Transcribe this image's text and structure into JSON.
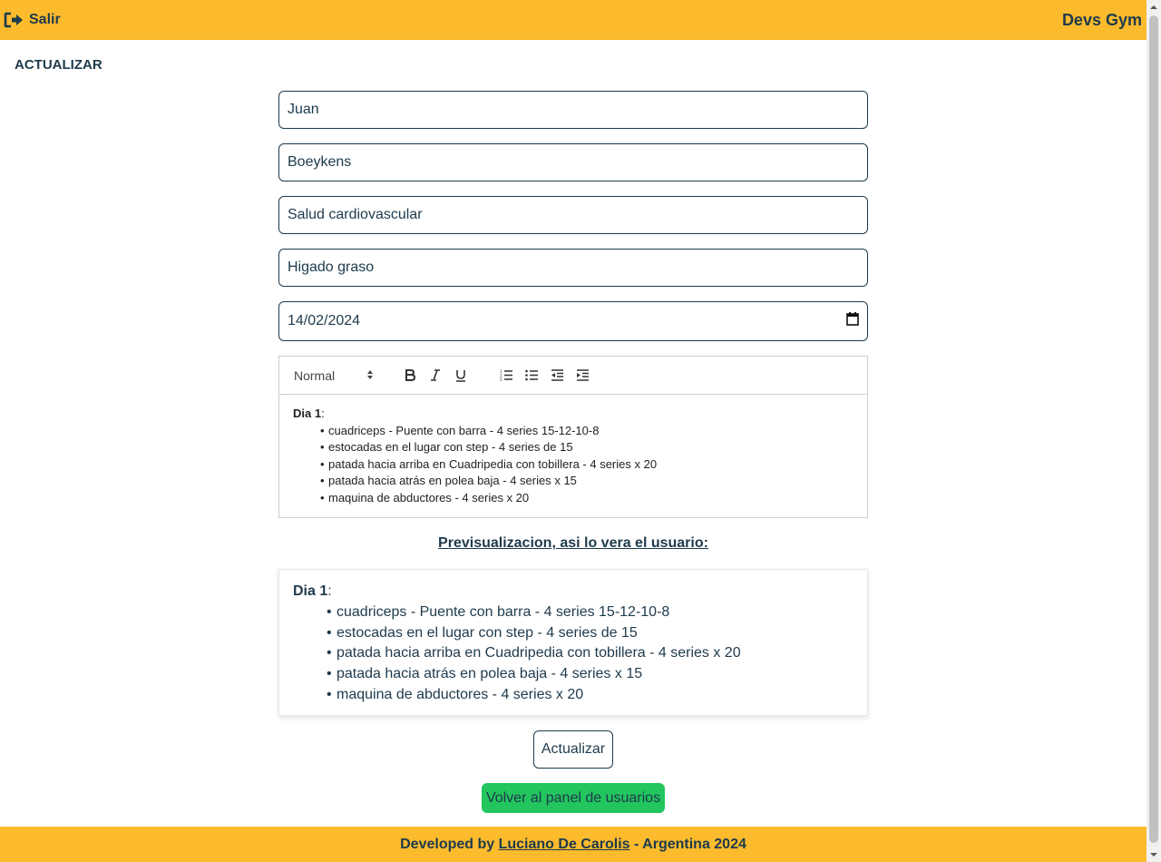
{
  "header": {
    "logout_label": "Salir",
    "brand": "Devs Gym"
  },
  "page": {
    "title": "ACTUALIZAR"
  },
  "form": {
    "nombre": "Juan",
    "apellido": "Boeykens",
    "objetivo": "Salud cardiovascular",
    "condicion": "Higado graso",
    "fecha": "14/02/2024"
  },
  "editor": {
    "format_selected": "Normal",
    "day_title": "Dia 1",
    "items": [
      "cuadriceps - Puente con barra - 4 series 15-12-10-8",
      "estocadas en el lugar con step - 4 series de 15",
      "patada hacia arriba en Cuadripedia con tobillera - 4 series x 20",
      "patada hacia atrás en polea baja - 4 series x 15",
      "maquina de abductores - 4 series x 20"
    ]
  },
  "preview": {
    "heading": "Previsualizacion, asi lo vera el usuario:",
    "day_title": "Dia 1",
    "items": [
      "cuadriceps - Puente con barra - 4 series 15-12-10-8",
      "estocadas en el lugar con step - 4 series de 15",
      "patada hacia arriba en Cuadripedia con tobillera - 4 series x 20",
      "patada hacia atrás en polea baja - 4 series x 15",
      "maquina de abductores - 4 series x 20"
    ]
  },
  "actions": {
    "update_label": "Actualizar",
    "back_label": "Volver al panel de usuarios"
  },
  "footer": {
    "prefix": "Developed by",
    "author": "Luciano De Carolis",
    "suffix": "- Argentina 2024"
  },
  "colors": {
    "brand_yellow": "#fbbb2d",
    "text_navy": "#1e3a4c",
    "success_green": "#22c55e"
  },
  "icons": {
    "logout": "logout-icon",
    "calendar": "calendar-icon"
  }
}
